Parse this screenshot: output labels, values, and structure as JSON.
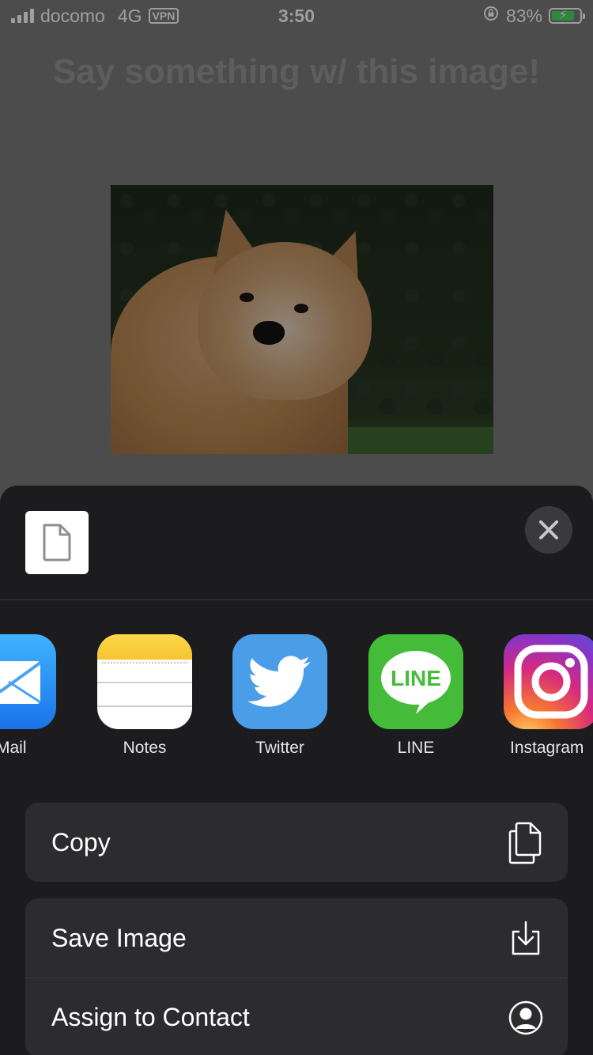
{
  "status_bar": {
    "carrier": "docomo",
    "network": "4G",
    "vpn": "VPN",
    "time": "3:50",
    "battery_percent": "83%",
    "battery_level": 0.83
  },
  "page": {
    "title": "Say something w/ this image!"
  },
  "share_sheet": {
    "apps": [
      {
        "label": "Mail",
        "icon": "mail-icon"
      },
      {
        "label": "Notes",
        "icon": "notes-icon"
      },
      {
        "label": "Twitter",
        "icon": "twitter-icon"
      },
      {
        "label": "LINE",
        "icon": "line-icon",
        "icon_text": "LINE"
      },
      {
        "label": "Instagram",
        "icon": "instagram-icon"
      }
    ],
    "actions": [
      {
        "label": "Copy",
        "icon": "copy-icon"
      },
      {
        "label": "Save Image",
        "icon": "save-image-icon"
      },
      {
        "label": "Assign to Contact",
        "icon": "contact-icon"
      }
    ]
  },
  "colors": {
    "sheet_background": "#1c1c1e",
    "action_background": "#2c2c2e",
    "twitter_blue": "#4a9ee8",
    "line_green": "#45bc39"
  }
}
